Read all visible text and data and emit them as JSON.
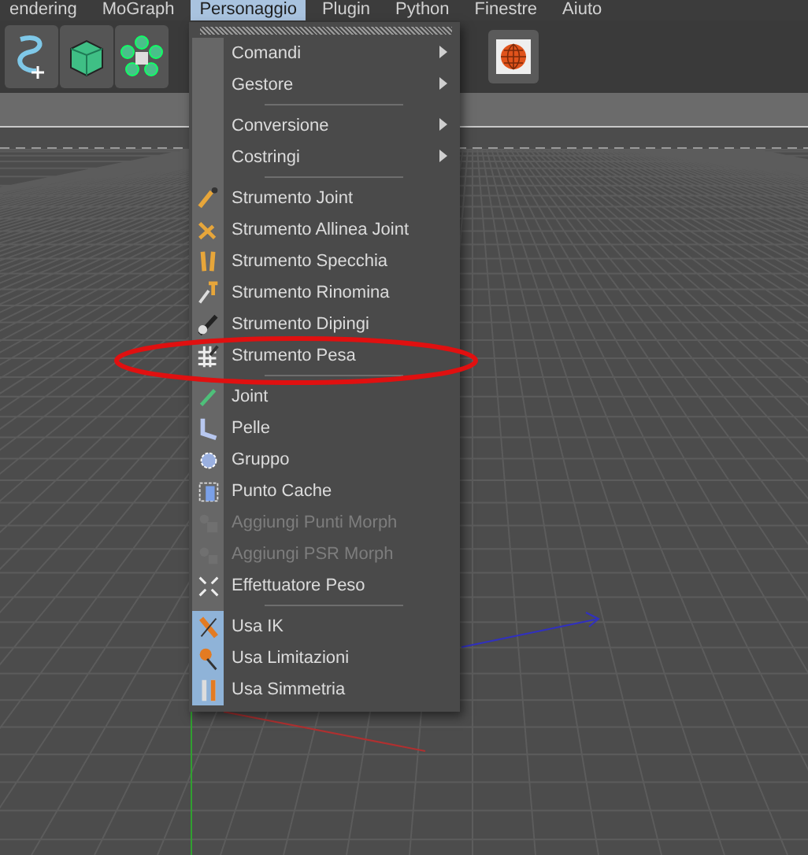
{
  "menubar": [
    {
      "label": "endering",
      "selected": false
    },
    {
      "label": "MoGraph",
      "selected": false
    },
    {
      "label": "Personaggio",
      "selected": true
    },
    {
      "label": "Plugin",
      "selected": false
    },
    {
      "label": "Python",
      "selected": false
    },
    {
      "label": "Finestre",
      "selected": false
    },
    {
      "label": "Aiuto",
      "selected": false
    }
  ],
  "menu": {
    "items": [
      {
        "kind": "submenu",
        "label": "Comandi",
        "disabled": false
      },
      {
        "kind": "submenu",
        "label": "Gestore",
        "disabled": false
      },
      {
        "kind": "separator"
      },
      {
        "kind": "submenu",
        "label": "Conversione",
        "disabled": false
      },
      {
        "kind": "submenu",
        "label": "Costringi",
        "disabled": false
      },
      {
        "kind": "separator"
      },
      {
        "kind": "item",
        "label": "Strumento Joint",
        "disabled": false,
        "checked": false
      },
      {
        "kind": "item",
        "label": "Strumento Allinea Joint",
        "disabled": false,
        "checked": false
      },
      {
        "kind": "item",
        "label": "Strumento Specchia",
        "disabled": false,
        "checked": false
      },
      {
        "kind": "item",
        "label": "Strumento Rinomina",
        "disabled": false,
        "checked": false
      },
      {
        "kind": "item",
        "label": "Strumento Dipingi",
        "disabled": false,
        "checked": false
      },
      {
        "kind": "item",
        "label": "Strumento Pesa",
        "disabled": false,
        "checked": false
      },
      {
        "kind": "separator"
      },
      {
        "kind": "item",
        "label": "Joint",
        "disabled": false,
        "checked": false
      },
      {
        "kind": "item",
        "label": "Pelle",
        "disabled": false,
        "checked": false
      },
      {
        "kind": "item",
        "label": "Gruppo",
        "disabled": false,
        "checked": false
      },
      {
        "kind": "item",
        "label": "Punto Cache",
        "disabled": false,
        "checked": false
      },
      {
        "kind": "item",
        "label": "Aggiungi Punti Morph",
        "disabled": true,
        "checked": false
      },
      {
        "kind": "item",
        "label": "Aggiungi PSR Morph",
        "disabled": true,
        "checked": false
      },
      {
        "kind": "item",
        "label": "Effettuatore Peso",
        "disabled": false,
        "checked": false
      },
      {
        "kind": "separator"
      },
      {
        "kind": "item",
        "label": "Usa IK",
        "disabled": false,
        "checked": true
      },
      {
        "kind": "item",
        "label": "Usa Limitazioni",
        "disabled": false,
        "checked": true
      },
      {
        "kind": "item",
        "label": "Usa Simmetria",
        "disabled": false,
        "checked": true
      }
    ]
  }
}
